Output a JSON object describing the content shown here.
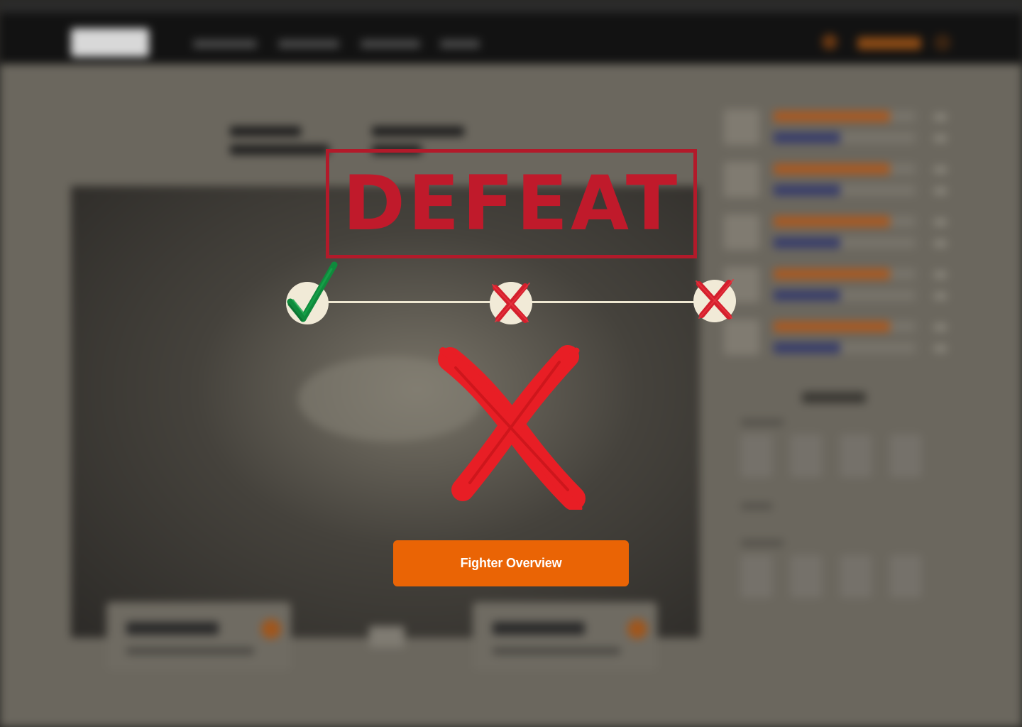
{
  "result": {
    "title": "DEFEAT",
    "color": "#c01a2b"
  },
  "rounds": [
    {
      "outcome": "win",
      "icon": "checkmark-icon",
      "color": "#0f8a3c"
    },
    {
      "outcome": "loss",
      "icon": "cross-icon",
      "color": "#d41f2c"
    },
    {
      "outcome": "loss",
      "icon": "cross-icon",
      "color": "#d41f2c"
    }
  ],
  "final_icon": "large-cross-icon",
  "actions": {
    "fighter_overview_label": "Fighter Overview",
    "button_color": "#ea6405"
  }
}
